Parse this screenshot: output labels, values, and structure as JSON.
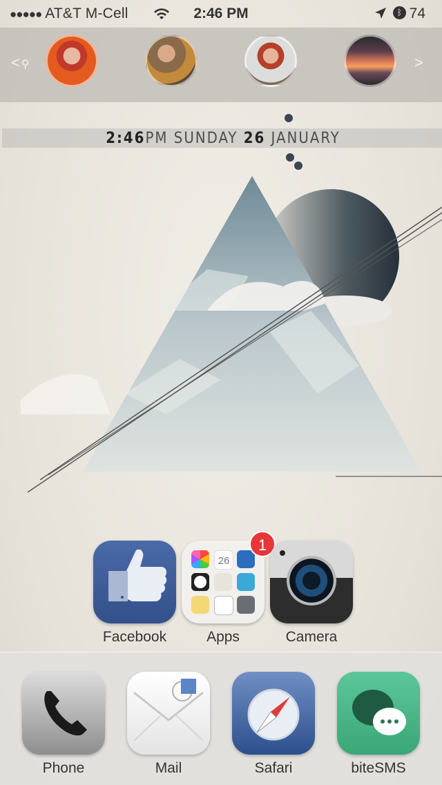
{
  "status_bar": {
    "signal_dots": "●●●●●",
    "carrier": "AT&T M-Cell",
    "time": "2:46 PM",
    "battery": "74"
  },
  "contacts": {
    "prev_arrow": "<",
    "next_arrow": ">",
    "people": [
      "contact-1",
      "contact-2",
      "contact-3",
      "contact-4"
    ]
  },
  "date_widget": {
    "hour_minute": "2:46",
    "ampm": "PM",
    "weekday": "SUNDAY",
    "day": "26",
    "month": "JANUARY"
  },
  "home_apps": [
    {
      "label": "Facebook"
    },
    {
      "label": "Apps",
      "badge": "1",
      "calendar_day": "26"
    },
    {
      "label": "Camera"
    }
  ],
  "dock": [
    {
      "label": "Phone"
    },
    {
      "label": "Mail"
    },
    {
      "label": "Safari"
    },
    {
      "label": "biteSMS"
    }
  ],
  "colors": {
    "facebook": "#3b5998",
    "bitesms": "#4bb98a",
    "badge": "#e6373b"
  }
}
